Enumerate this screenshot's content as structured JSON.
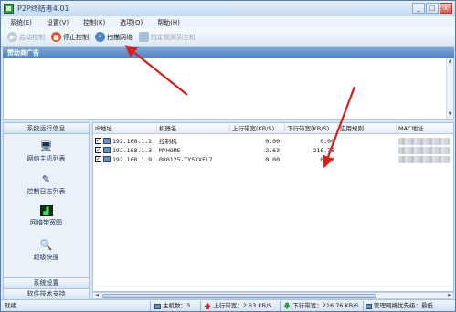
{
  "window": {
    "title": "P2P终结者4.01",
    "controls": {
      "minimize": "_",
      "maximize": "□",
      "close": "x"
    }
  },
  "menu": [
    "系统(E)",
    "设置(V)",
    "控制(K)",
    "选项(O)",
    "帮助(H)"
  ],
  "toolbar": {
    "start_label": "启动控制",
    "stop_label": "停止控制",
    "scan_label": "扫描网络",
    "rule_label": "指定规则到主机"
  },
  "sponsor": {
    "title": "赞助商广告"
  },
  "sidebar": {
    "header": "系统运行信息",
    "items": [
      {
        "label": "网络主机列表",
        "icon": "host-list-icon"
      },
      {
        "label": "控制日志列表",
        "icon": "log-list-icon"
      },
      {
        "label": "网络带宽图",
        "icon": "bandwidth-chart-icon"
      },
      {
        "label": "超级快搜",
        "icon": "super-search-icon"
      }
    ],
    "footer1": "系统设置",
    "footer2": "软件技术支持"
  },
  "table": {
    "columns": [
      "IP地址",
      "机器名",
      "上行带宽(KB/S)",
      "下行带宽(KB/S)",
      "应用规则",
      "MAC地址"
    ],
    "rows": [
      {
        "checked": true,
        "ip": "192.168.1.2",
        "name": "控制机",
        "up": "0.00",
        "down": "0.00",
        "rule": ""
      },
      {
        "checked": true,
        "ip": "192.168.1.3",
        "name": "MYHOME",
        "up": "2.63",
        "down": "216.76",
        "rule": ""
      },
      {
        "checked": true,
        "ip": "192.168.1.9",
        "name": "080125-TYSXXFL7",
        "up": "0.00",
        "down": "0.00",
        "rule": ""
      }
    ]
  },
  "status": {
    "ready": "就绪",
    "hosts": "主机数：3",
    "upload": "上行带宽：2.63 KB/S",
    "download": "下行带宽：216.76 KB/S",
    "priority": "管理网络优先级：最低"
  },
  "colors": {
    "accent": "#4f82c2",
    "annotation": "#d6201a"
  }
}
